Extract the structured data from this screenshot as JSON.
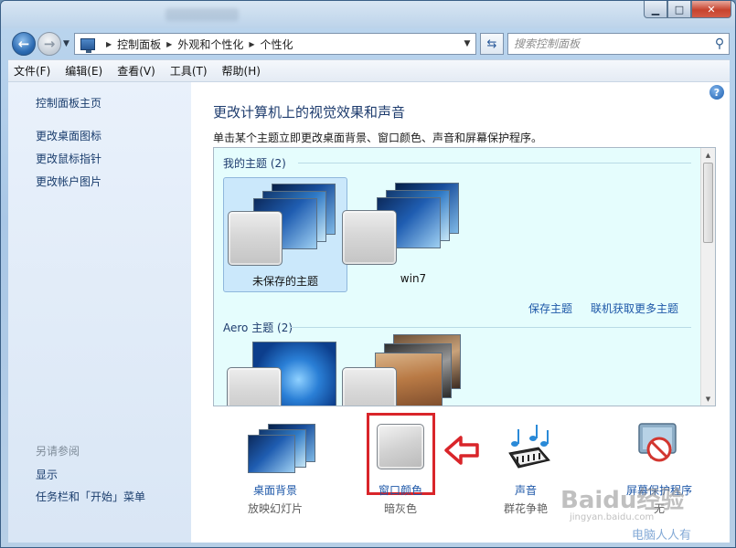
{
  "window": {
    "controls": {
      "minimize": "▁",
      "maximize": "□",
      "close": "✕"
    }
  },
  "address": {
    "crumbs": [
      "控制面板",
      "外观和个性化",
      "个性化"
    ],
    "search_placeholder": "搜索控制面板"
  },
  "menu": [
    "文件(F)",
    "编辑(E)",
    "查看(V)",
    "工具(T)",
    "帮助(H)"
  ],
  "sidebar": {
    "home": "控制面板主页",
    "links": [
      "更改桌面图标",
      "更改鼠标指针",
      "更改帐户图片"
    ],
    "see_also_heading": "另请参阅",
    "see_also": [
      "显示",
      "任务栏和「开始」菜单"
    ]
  },
  "main": {
    "title": "更改计算机上的视觉效果和声音",
    "subtitle": "单击某个主题立即更改桌面背景、窗口颜色、声音和屏幕保护程序。",
    "help": "?",
    "gallery": {
      "my_themes_header": "我的主题 (2)",
      "my_themes": [
        {
          "label": "未保存的主题",
          "selected": true
        },
        {
          "label": "win7",
          "selected": false
        }
      ],
      "save_theme": "保存主题",
      "get_more": "联机获取更多主题",
      "aero_header": "Aero 主题 (2)"
    },
    "bottom": [
      {
        "label": "桌面背景",
        "sub": "放映幻灯片"
      },
      {
        "label": "窗口颜色",
        "sub": "暗灰色"
      },
      {
        "label": "声音",
        "sub": "群花争艳"
      },
      {
        "label": "屏幕保护程序",
        "sub": "无"
      }
    ]
  },
  "watermark": {
    "brand": "Baidu经验",
    "url": "jingyan.baidu.com",
    "slogan": "电脑人人有"
  },
  "colors": {
    "link": "#1d57a8",
    "title": "#1e3c6e",
    "highlight": "#d9252a",
    "gallery_bg": "#e5fdfd"
  }
}
